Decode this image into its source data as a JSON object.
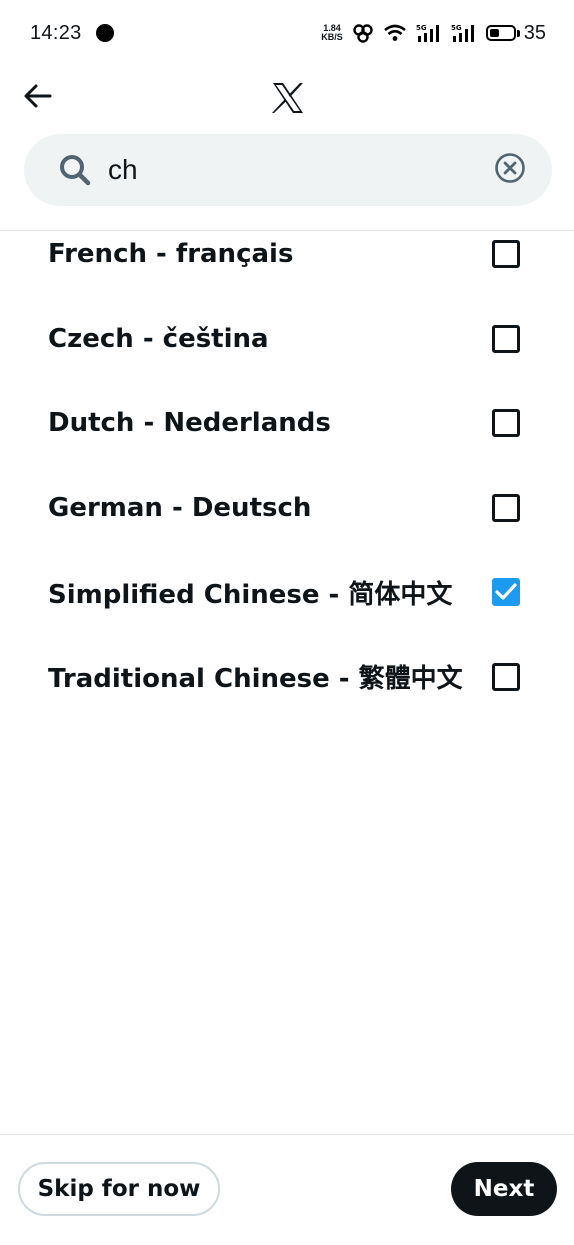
{
  "status_bar": {
    "time": "14:23",
    "net_speed_value": "1.84",
    "net_speed_unit": "KB/S",
    "battery": "35",
    "icons": [
      "notification-dot-icon",
      "link-icon",
      "wifi-icon",
      "signal-5g-icon",
      "signal-5g-icon",
      "battery-icon"
    ]
  },
  "header": {
    "back_icon": "arrow-left-icon",
    "logo_icon": "x-logo-icon"
  },
  "search": {
    "value": "ch",
    "icon": "search-icon",
    "clear_icon": "clear-circle-icon"
  },
  "languages": [
    {
      "label": "French - français",
      "checked": false
    },
    {
      "label": "Czech - čeština",
      "checked": false
    },
    {
      "label": "Dutch - Nederlands",
      "checked": false
    },
    {
      "label": "German - Deutsch",
      "checked": false
    },
    {
      "label": "Simplified Chinese - 简体中文",
      "checked": true
    },
    {
      "label": "Traditional Chinese - 繁體中文",
      "checked": false
    }
  ],
  "footer": {
    "skip_label": "Skip for now",
    "next_label": "Next"
  },
  "colors": {
    "accent": "#1d9bf0",
    "text": "#0f1419",
    "search_bg": "#eff3f4",
    "button_dark": "#0f1419"
  }
}
